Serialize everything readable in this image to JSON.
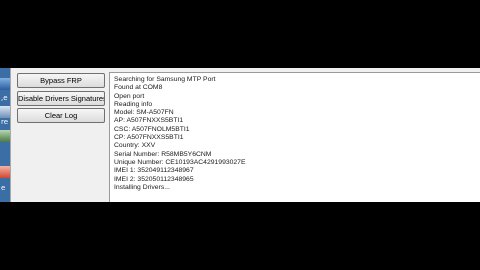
{
  "desktop": {
    "icon_letters": [
      "",
      ",e",
      "re",
      "e"
    ]
  },
  "buttons": {
    "bypass_frp": "Bypass FRP",
    "disable_drivers": "Disable Drivers Signatures",
    "clear_log": "Clear Log"
  },
  "log": {
    "lines": [
      "Searching for Samsung MTP Port",
      "Found at COM8",
      "Open port",
      "Reading info",
      "Model: SM-A507FN",
      "AP: A507FNXXS5BTI1",
      "CSC: A507FNOLM5BTI1",
      "CP: A507FNXXS5BTI1",
      "Country: XXV",
      "Serial Number: R58MB5Y6CNM",
      "Unique Number: CE10193AC4291993027E",
      "IMEI 1: 352049112348967",
      "IMEI 2: 352050112348965",
      "Installing Drivers..."
    ]
  }
}
